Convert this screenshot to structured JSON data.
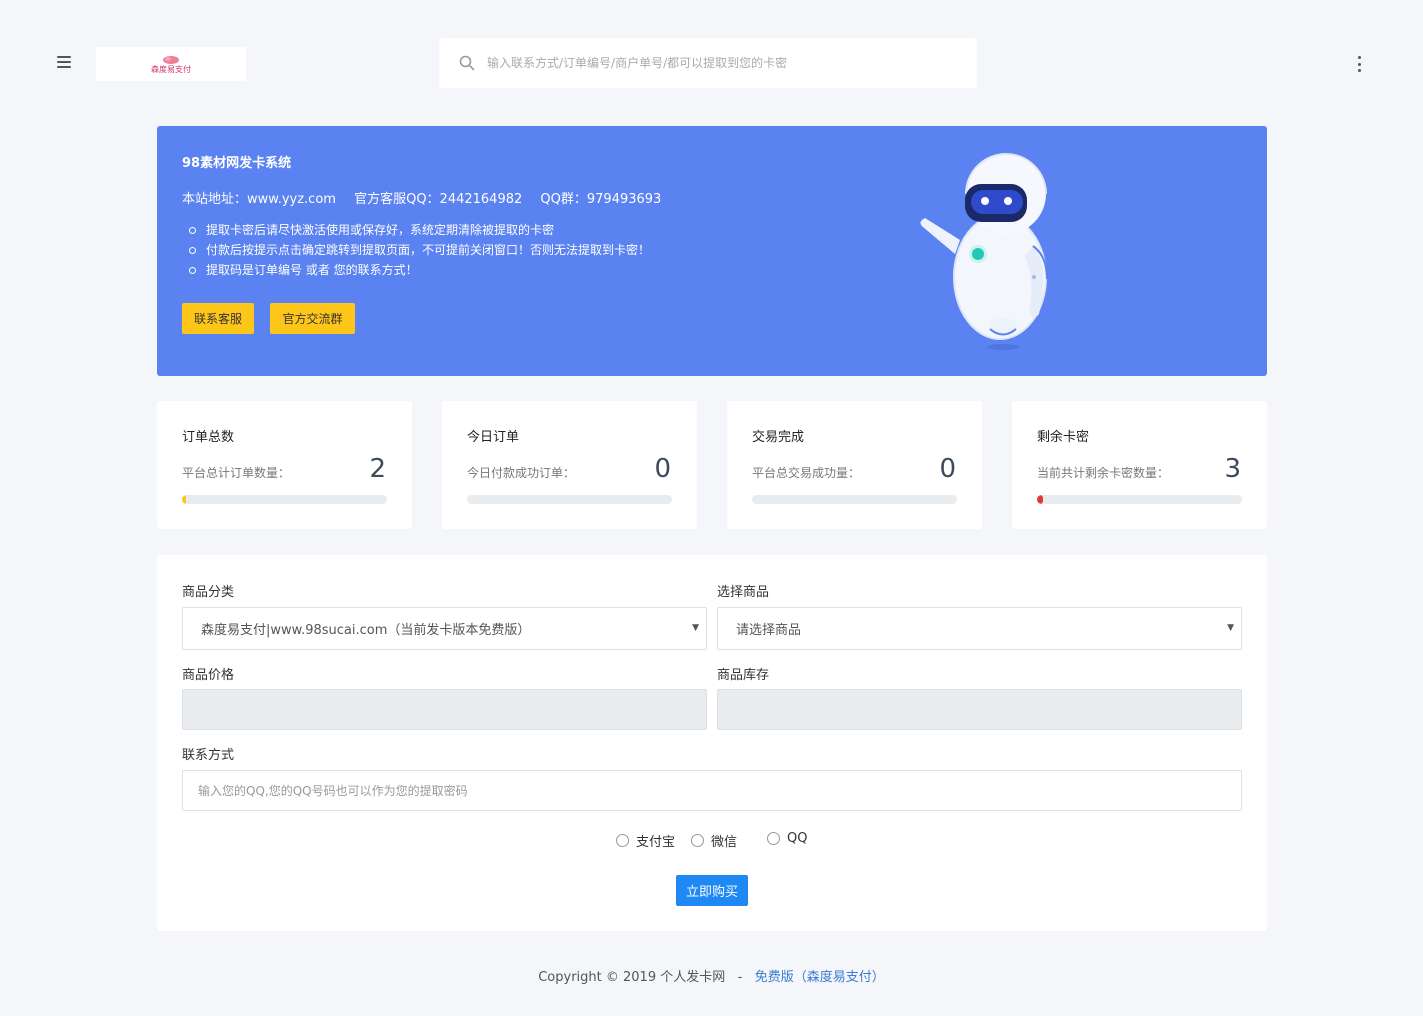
{
  "header": {
    "search_placeholder": "输入联系方式/订单编号/商户单号/都可以提取到您的卡密",
    "logo_text": "森度易支付"
  },
  "banner": {
    "title": "98素材网发卡系统",
    "site_label": "本站地址：www.yyz.com",
    "qq_service": "官方客服QQ：2442164982",
    "qq_group": "QQ群：979493693",
    "notes": [
      "提取卡密后请尽快激活使用或保存好，系统定期清除被提取的卡密",
      "付款后按提示点击确定跳转到提取页面，不可提前关闭窗口！否则无法提取到卡密！",
      "提取码是订单编号 或者 您的联系方式！"
    ],
    "btn_contact": "联系客服",
    "btn_group": "官方交流群"
  },
  "stats": [
    {
      "title": "订单总数",
      "sub": "平台总计订单数量：",
      "value": "2",
      "bar_percent": 2,
      "bar_color": "#ffc61a"
    },
    {
      "title": "今日订单",
      "sub": "今日付款成功订单：",
      "value": "0",
      "bar_percent": 0,
      "bar_color": "#1e88f5"
    },
    {
      "title": "交易完成",
      "sub": "平台总交易成功量：",
      "value": "0",
      "bar_percent": 0,
      "bar_color": "#1e88f5"
    },
    {
      "title": "剩余卡密",
      "sub": "当前共计剩余卡密数量：",
      "value": "3",
      "bar_percent": 3,
      "bar_color": "#e53935"
    }
  ],
  "form": {
    "category_label": "商品分类",
    "category_value": "森度易支付|www.98sucai.com（当前发卡版本免费版）",
    "product_label": "选择商品",
    "product_value": "请选择商品",
    "price_label": "商品价格",
    "stock_label": "商品库存",
    "contact_label": "联系方式",
    "contact_placeholder": "输入您的QQ,您的QQ号码也可以作为您的提取密码",
    "pay_methods": [
      "支付宝",
      "微信",
      "QQ"
    ],
    "buy_button": "立即购买"
  },
  "footer": {
    "copyright": "Copyright © 2019 个人发卡网",
    "separator": "-",
    "link": "免费版（森度易支付）"
  }
}
